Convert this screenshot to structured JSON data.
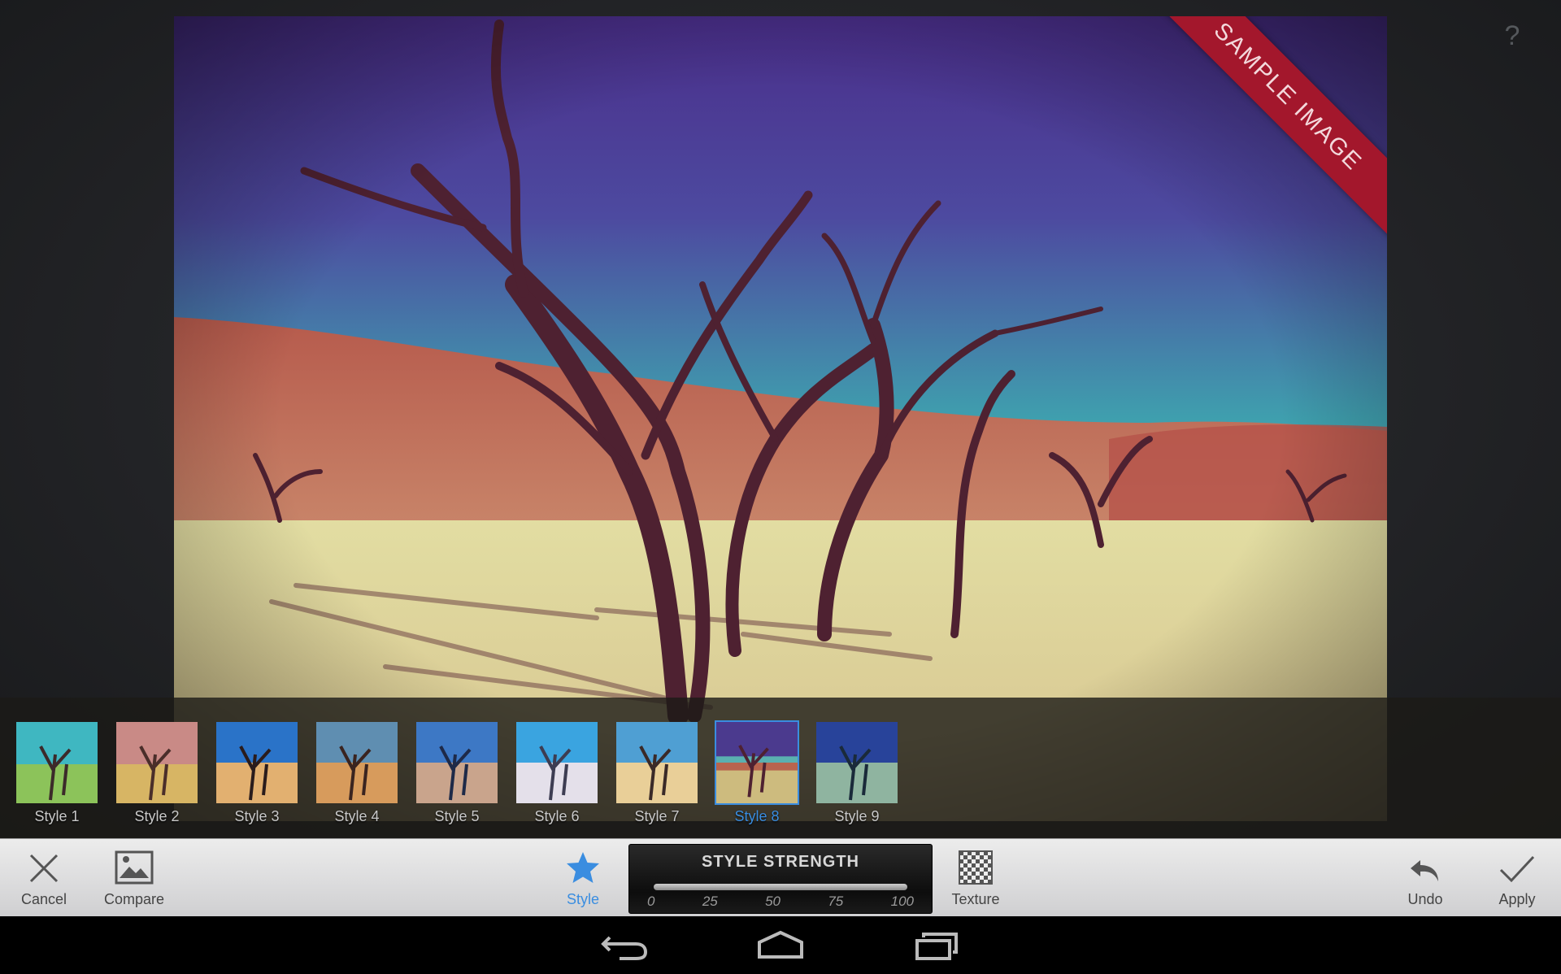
{
  "help": {
    "label": "?"
  },
  "ribbon": {
    "text": "SAMPLE IMAGE"
  },
  "styles": [
    {
      "label": "Style 1",
      "selected": false
    },
    {
      "label": "Style 2",
      "selected": false
    },
    {
      "label": "Style 3",
      "selected": false
    },
    {
      "label": "Style 4",
      "selected": false
    },
    {
      "label": "Style 5",
      "selected": false
    },
    {
      "label": "Style 6",
      "selected": false
    },
    {
      "label": "Style 7",
      "selected": false
    },
    {
      "label": "Style 8",
      "selected": true
    },
    {
      "label": "Style 9",
      "selected": false
    }
  ],
  "toolbar": {
    "cancel_label": "Cancel",
    "compare_label": "Compare",
    "style_label": "Style",
    "texture_label": "Texture",
    "undo_label": "Undo",
    "apply_label": "Apply"
  },
  "strength": {
    "title": "STYLE STRENGTH",
    "ticks": [
      "0",
      "25",
      "50",
      "75",
      "100"
    ]
  },
  "colors": {
    "accent": "#3a8de0",
    "ribbon": "#a3172c"
  }
}
